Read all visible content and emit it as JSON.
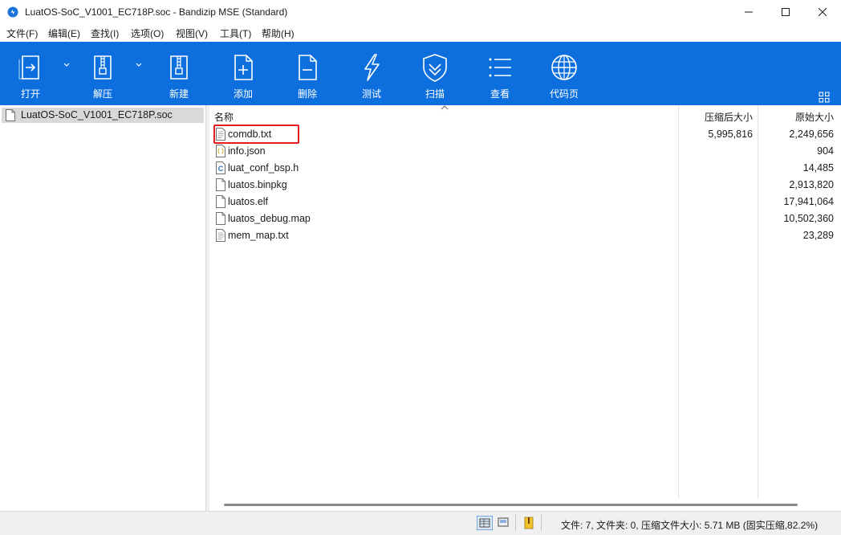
{
  "window": {
    "title": "LuatOS-SoC_V1001_EC718P.soc - Bandizip MSE (Standard)"
  },
  "menu": [
    "文件(F)",
    "编辑(E)",
    "查找(I)",
    "选项(O)",
    "视图(V)",
    "工具(T)",
    "帮助(H)"
  ],
  "toolbar": {
    "background": "#0d6fdd",
    "buttons": [
      {
        "label": "打开",
        "icon": "open-icon"
      },
      {
        "label": "解压",
        "icon": "extract-icon"
      },
      {
        "label": "新建",
        "icon": "new-archive-icon"
      },
      {
        "label": "添加",
        "icon": "add-file-icon"
      },
      {
        "label": "删除",
        "icon": "delete-file-icon"
      },
      {
        "label": "测试",
        "icon": "test-lightning-icon"
      },
      {
        "label": "扫描",
        "icon": "scan-shield-icon"
      },
      {
        "label": "查看",
        "icon": "view-list-icon"
      },
      {
        "label": "代码页",
        "icon": "codepage-globe-icon"
      }
    ]
  },
  "tree": {
    "items": [
      {
        "label": "LuatOS-SoC_V1001_EC718P.soc"
      }
    ]
  },
  "file_list": {
    "columns": {
      "name": "名称",
      "compressed": "压缩后大小",
      "original": "原始大小"
    },
    "rows": [
      {
        "name": "comdb.txt",
        "compressed": "5,995,816",
        "original": "2,249,656",
        "icon": "text-file-icon"
      },
      {
        "name": "info.json",
        "compressed": "",
        "original": "904",
        "icon": "json-file-icon"
      },
      {
        "name": "luat_conf_bsp.h",
        "compressed": "",
        "original": "14,485",
        "icon": "c-header-file-icon"
      },
      {
        "name": "luatos.binpkg",
        "compressed": "",
        "original": "2,913,820",
        "icon": "generic-file-icon"
      },
      {
        "name": "luatos.elf",
        "compressed": "",
        "original": "17,941,064",
        "icon": "generic-file-icon"
      },
      {
        "name": "luatos_debug.map",
        "compressed": "",
        "original": "10,502,360",
        "icon": "generic-file-icon"
      },
      {
        "name": "mem_map.txt",
        "compressed": "",
        "original": "23,289",
        "icon": "text-file-icon"
      }
    ]
  },
  "status": {
    "text": "文件: 7, 文件夹: 0, 压缩文件大小: 5.71 MB (固实压缩,82.2%)"
  },
  "colors": {
    "highlight_box": "#e01e1e"
  }
}
